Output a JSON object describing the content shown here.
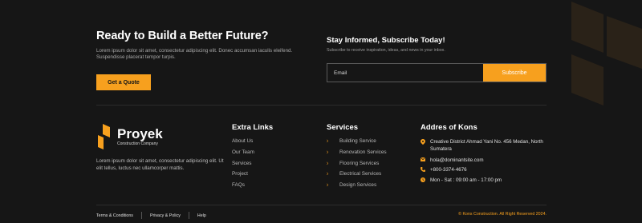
{
  "cta": {
    "title": "Ready to Build a Better Future?",
    "text": "Lorem ipsum dolor sit amet, consectetur adipiscing elit. Donec accumsan iaculis eleifend. Suspendisse placerat tempor turpis.",
    "button": "Get a Quote"
  },
  "subscribe": {
    "title": "Stay Informed, Subscribe Today!",
    "text": "Subscribe to receive inspiration, ideas, and news in your inbox.",
    "email_placeholder": "Email",
    "button": "Subscribe"
  },
  "brand": {
    "name": "Proyek",
    "tagline": "Construction Company",
    "description": "Lorem ipsum dolor sit amet, consectetur adipiscing elit. Ut elit tellus, luctus nec ullamcorper mattis."
  },
  "extra_links": {
    "title": "Extra Links",
    "items": [
      "About Us",
      "Our Team",
      "Services",
      "Project",
      "FAQs"
    ]
  },
  "services": {
    "title": "Services",
    "items": [
      "Building Service",
      "Renovation Services",
      "Flooring Services",
      "Electrical Services",
      "Design Services"
    ]
  },
  "address": {
    "title": "Addres of Kons",
    "location": "Creative District Ahmad Yani No. 456 Medan, North Sumatera",
    "email": "hola@dominantsite.com",
    "phone": "+800-3374-4676",
    "hours": "Mon - Sat : 09:00 am - 17:00 pm"
  },
  "bottom": {
    "terms": "Terms & Conditions",
    "privacy": "Privacy & Policy",
    "help": "Help",
    "copyright": "© Kons Construction. All Right Reserved 2024."
  },
  "colors": {
    "accent": "#f7a01e",
    "background": "#161616"
  }
}
